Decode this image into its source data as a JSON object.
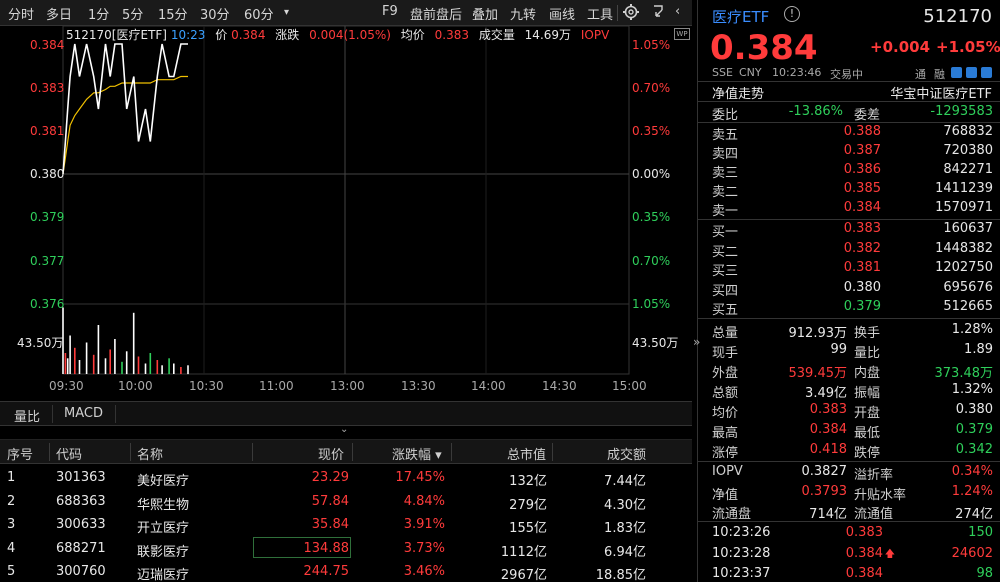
{
  "toolbar": {
    "items": [
      "分时",
      "多日",
      "1分",
      "5分",
      "15分",
      "30分",
      "60分",
      "▾",
      "F9",
      "盘前盘后",
      "叠加",
      "九转",
      "画线",
      "工具"
    ]
  },
  "chart": {
    "header": {
      "code_name": "512170[医疗ETF]",
      "time": "10:23",
      "price_label": "价",
      "price": "0.384",
      "change_label": "涨跌",
      "change": "0.004(1.05%)",
      "avg_label": "均价",
      "avg": "0.383",
      "vol_label": "成交量",
      "vol": "14.69万",
      "iopv": "IOPV"
    },
    "price_ticks": [
      "0.384",
      "0.383",
      "0.381",
      "0.380",
      "0.379",
      "0.377",
      "0.376"
    ],
    "pct_ticks": [
      "1.05%",
      "0.70%",
      "0.35%",
      "0.00%",
      "0.35%",
      "0.70%",
      "1.05%"
    ],
    "vol_tick": "43.50万",
    "time_ticks": [
      "09:30",
      "10:00",
      "10:30",
      "11:00",
      "13:00",
      "13:30",
      "14:00",
      "14:30",
      "15:00"
    ],
    "badge": "WP"
  },
  "chart_data": {
    "type": "line",
    "title": "512170[医疗ETF]",
    "xlabel": "",
    "ylabel": "",
    "ylim": [
      0.376,
      0.384
    ],
    "x": [
      "09:30",
      "09:31",
      "09:32",
      "09:33",
      "09:35",
      "09:37",
      "09:40",
      "09:43",
      "09:45",
      "09:48",
      "09:50",
      "09:52",
      "09:55",
      "09:57",
      "10:00",
      "10:02",
      "10:05",
      "10:07",
      "10:10",
      "10:12",
      "10:15",
      "10:17",
      "10:20",
      "10:23"
    ],
    "series": [
      {
        "name": "价",
        "values": [
          0.38,
          0.381,
          0.382,
          0.383,
          0.384,
          0.383,
          0.384,
          0.383,
          0.382,
          0.384,
          0.383,
          0.384,
          0.384,
          0.382,
          0.383,
          0.381,
          0.382,
          0.381,
          0.383,
          0.384,
          0.383,
          0.383,
          0.384,
          0.384
        ]
      },
      {
        "name": "均价",
        "values": [
          0.38,
          0.3805,
          0.381,
          0.3815,
          0.3818,
          0.382,
          0.3823,
          0.3825,
          0.3825,
          0.3826,
          0.3827,
          0.3827,
          0.3828,
          0.3828,
          0.3828,
          0.3828,
          0.3828,
          0.3828,
          0.3829,
          0.3829,
          0.3829,
          0.3829,
          0.383,
          0.383
        ]
      }
    ],
    "volume": [
      38,
      12,
      9,
      22,
      15,
      8,
      18,
      11,
      28,
      9,
      14,
      20,
      7,
      13,
      35,
      10,
      6,
      12,
      8,
      5,
      9,
      6,
      4,
      5
    ],
    "volume_colors": [
      "w",
      "r",
      "w",
      "w",
      "r",
      "w",
      "w",
      "r",
      "w",
      "w",
      "r",
      "w",
      "g",
      "w",
      "w",
      "r",
      "w",
      "g",
      "r",
      "w",
      "g",
      "w",
      "r",
      "w"
    ]
  },
  "subtabs": [
    "量比",
    "MACD"
  ],
  "table": {
    "headers": [
      "序号",
      "代码",
      "名称",
      "现价",
      "涨跌幅 ▾",
      "总市值",
      "成交额"
    ],
    "rows": [
      [
        "1",
        "301363",
        "美好医疗",
        "23.29",
        "17.45%",
        "132亿",
        "7.44亿"
      ],
      [
        "2",
        "688363",
        "华熙生物",
        "57.84",
        "4.84%",
        "279亿",
        "4.30亿"
      ],
      [
        "3",
        "300633",
        "开立医疗",
        "35.84",
        "3.91%",
        "155亿",
        "1.83亿"
      ],
      [
        "4",
        "688271",
        "联影医疗",
        "134.88",
        "3.73%",
        "1112亿",
        "6.94亿"
      ],
      [
        "5",
        "300760",
        "迈瑞医疗",
        "244.75",
        "3.46%",
        "2967亿",
        "18.85亿"
      ]
    ]
  },
  "quote": {
    "name": "医疗ETF",
    "code": "512170",
    "price": "0.384",
    "change": "+0.004",
    "change_pct": "+1.05%",
    "exchange": "SSE",
    "currency": "CNY",
    "time": "10:23:46",
    "status": "交易中",
    "tags": [
      "通",
      "融"
    ],
    "nav_trend": "净值走势",
    "index_name": "华宝中证医疗ETF"
  },
  "commission": {
    "ratio_label": "委比",
    "ratio": "-13.86%",
    "diff_label": "委差",
    "diff": "-1293583"
  },
  "asks": [
    {
      "label": "卖五",
      "price": "0.388",
      "vol": "768832"
    },
    {
      "label": "卖四",
      "price": "0.387",
      "vol": "720380"
    },
    {
      "label": "卖三",
      "price": "0.386",
      "vol": "842271"
    },
    {
      "label": "卖二",
      "price": "0.385",
      "vol": "1411239"
    },
    {
      "label": "卖一",
      "price": "0.384",
      "vol": "1570971"
    }
  ],
  "bids": [
    {
      "label": "买一",
      "price": "0.383",
      "vol": "160637"
    },
    {
      "label": "买二",
      "price": "0.382",
      "vol": "1448382"
    },
    {
      "label": "买三",
      "price": "0.381",
      "vol": "1202750"
    },
    {
      "label": "买四",
      "price": "0.380",
      "vol": "695676"
    },
    {
      "label": "买五",
      "price": "0.379",
      "vol": "512665"
    }
  ],
  "stats": [
    [
      {
        "l": "总量",
        "v": "912.93万"
      },
      {
        "l": "换手",
        "v": "1.28%"
      }
    ],
    [
      {
        "l": "现手",
        "v": "99"
      },
      {
        "l": "量比",
        "v": "1.89"
      }
    ],
    [
      {
        "l": "外盘",
        "v": "539.45万"
      },
      {
        "l": "内盘",
        "v": "373.48万"
      }
    ],
    [
      {
        "l": "总额",
        "v": "3.49亿"
      },
      {
        "l": "振幅",
        "v": "1.32%"
      }
    ],
    [
      {
        "l": "均价",
        "v": "0.383"
      },
      {
        "l": "开盘",
        "v": "0.380"
      }
    ],
    [
      {
        "l": "最高",
        "v": "0.384"
      },
      {
        "l": "最低",
        "v": "0.379"
      }
    ],
    [
      {
        "l": "涨停",
        "v": "0.418"
      },
      {
        "l": "跌停",
        "v": "0.342"
      }
    ]
  ],
  "stats2": [
    [
      {
        "l": "IOPV",
        "v": "0.3827"
      },
      {
        "l": "溢折率",
        "v": "0.34%"
      }
    ],
    [
      {
        "l": "净值",
        "v": "0.3793"
      },
      {
        "l": "升贴水率",
        "v": "1.24%"
      }
    ],
    [
      {
        "l": "流通盘",
        "v": "714亿"
      },
      {
        "l": "流通值",
        "v": "274亿"
      }
    ]
  ],
  "ticks": [
    {
      "time": "10:23:26",
      "price": "0.383",
      "arrow": "",
      "vol": "150"
    },
    {
      "time": "10:23:28",
      "price": "0.384",
      "arrow": "🡅",
      "vol": "24602"
    },
    {
      "time": "10:23:37",
      "price": "0.384",
      "arrow": "",
      "vol": "98"
    }
  ],
  "colors": {
    "up": "#ff3b3b",
    "down": "#2fcf5b",
    "avg_line": "#f0c000",
    "price_line": "#ffffff"
  }
}
